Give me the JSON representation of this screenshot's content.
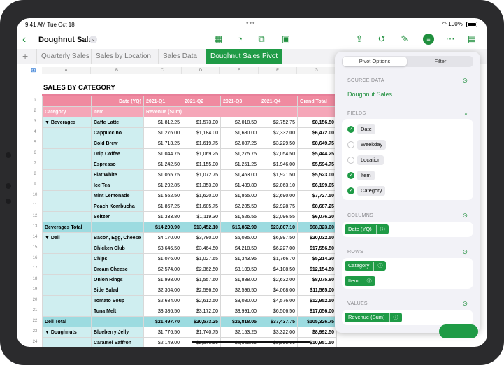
{
  "status": {
    "time": "9:41 AM  Tue Oct 18",
    "battery": "100%"
  },
  "toolbar": {
    "title": "Doughnut Sales"
  },
  "tabs": [
    "Quarterly Sales",
    "Sales by Location",
    "Sales Data",
    "Doughnut Sales Pivot"
  ],
  "sheet": {
    "title": "SALES BY CATEGORY",
    "columns": [
      "A",
      "B",
      "C",
      "D",
      "E",
      "F",
      "G"
    ],
    "header1": {
      "date_label": "Date (YQ)",
      "q1": "2021-Q1",
      "q2": "2021-Q2",
      "q3": "2021-Q3",
      "q4": "2021-Q4",
      "total": "Grand Total"
    },
    "header2": {
      "category": "Category",
      "item": "Item",
      "revenue": "Revenue (Sum)"
    },
    "rows": [
      {
        "n": "3",
        "cat": "▼ Beverages",
        "item": "Caffe Latte",
        "v": [
          "$1,812.25",
          "$1,573.00",
          "$2,018.50",
          "$2,752.75",
          "$8,156.50"
        ]
      },
      {
        "n": "4",
        "cat": "",
        "item": "Cappuccino",
        "v": [
          "$1,276.00",
          "$1,184.00",
          "$1,680.00",
          "$2,332.00",
          "$6,472.00"
        ]
      },
      {
        "n": "5",
        "cat": "",
        "item": "Cold Brew",
        "v": [
          "$1,713.25",
          "$1,619.75",
          "$2,087.25",
          "$3,229.50",
          "$8,649.75"
        ]
      },
      {
        "n": "6",
        "cat": "",
        "item": "Drip Coffee",
        "v": [
          "$1,044.75",
          "$1,069.25",
          "$1,275.75",
          "$2,054.50",
          "$5,444.25"
        ]
      },
      {
        "n": "7",
        "cat": "",
        "item": "Espresso",
        "v": [
          "$1,242.50",
          "$1,155.00",
          "$1,251.25",
          "$1,946.00",
          "$5,594.75"
        ]
      },
      {
        "n": "8",
        "cat": "",
        "item": "Flat White",
        "v": [
          "$1,065.75",
          "$1,072.75",
          "$1,463.00",
          "$1,921.50",
          "$5,523.00"
        ]
      },
      {
        "n": "9",
        "cat": "",
        "item": "Ice Tea",
        "v": [
          "$1,292.85",
          "$1,353.30",
          "$1,489.80",
          "$2,063.10",
          "$6,199.05"
        ]
      },
      {
        "n": "10",
        "cat": "",
        "item": "Mint Lemonade",
        "v": [
          "$1,552.50",
          "$1,620.00",
          "$1,865.00",
          "$2,690.00",
          "$7,727.50"
        ]
      },
      {
        "n": "11",
        "cat": "",
        "item": "Peach Kombucha",
        "v": [
          "$1,867.25",
          "$1,685.75",
          "$2,205.50",
          "$2,928.75",
          "$8,687.25"
        ]
      },
      {
        "n": "12",
        "cat": "",
        "item": "Seltzer",
        "v": [
          "$1,333.80",
          "$1,119.30",
          "$1,526.55",
          "$2,096.55",
          "$6,076.20"
        ]
      },
      {
        "n": "13",
        "cat": "Beverages Total",
        "item": "",
        "total": true,
        "v": [
          "$14,200.90",
          "$13,452.10",
          "$16,862.90",
          "$23,807.10",
          "$68,323.00"
        ]
      },
      {
        "n": "14",
        "cat": "▼ Deli",
        "item": "Bacon, Egg, Cheese",
        "v": [
          "$4,170.00",
          "$3,780.00",
          "$5,085.00",
          "$6,997.50",
          "$20,032.50"
        ]
      },
      {
        "n": "15",
        "cat": "",
        "item": "Chicken Club",
        "v": [
          "$3,646.50",
          "$3,464.50",
          "$4,218.50",
          "$6,227.00",
          "$17,556.50"
        ]
      },
      {
        "n": "16",
        "cat": "",
        "item": "Chips",
        "v": [
          "$1,076.00",
          "$1,027.65",
          "$1,343.95",
          "$1,766.70",
          "$5,214.30"
        ]
      },
      {
        "n": "17",
        "cat": "",
        "item": "Cream Cheese",
        "v": [
          "$2,574.00",
          "$2,362.50",
          "$3,109.50",
          "$4,108.50",
          "$12,154.50"
        ]
      },
      {
        "n": "18",
        "cat": "",
        "item": "Onion Rings",
        "v": [
          "$1,998.00",
          "$1,557.60",
          "$1,888.00",
          "$2,632.00",
          "$8,075.60"
        ]
      },
      {
        "n": "19",
        "cat": "",
        "item": "Side Salad",
        "v": [
          "$2,304.00",
          "$2,596.50",
          "$2,596.50",
          "$4,068.00",
          "$11,565.00"
        ]
      },
      {
        "n": "20",
        "cat": "",
        "item": "Tomato Soup",
        "v": [
          "$2,684.00",
          "$2,612.50",
          "$3,080.00",
          "$4,576.00",
          "$12,952.50"
        ]
      },
      {
        "n": "21",
        "cat": "",
        "item": "Tuna Melt",
        "v": [
          "$3,386.50",
          "$3,172.00",
          "$3,991.00",
          "$6,506.50",
          "$17,056.00"
        ]
      },
      {
        "n": "22",
        "cat": "Deli Total",
        "item": "",
        "total": true,
        "v": [
          "$21,497.70",
          "$20,573.25",
          "$25,818.05",
          "$37,437.75",
          "$105,326.75"
        ]
      },
      {
        "n": "23",
        "cat": "▼ Doughnuts",
        "item": "Blueberry Jelly",
        "v": [
          "$1,776.50",
          "$1,740.75",
          "$2,153.25",
          "$3,322.00",
          "$8,992.50"
        ]
      },
      {
        "n": "24",
        "cat": "",
        "item": "Caramel Saffron",
        "v": [
          "$2,149.00",
          "$2,376.00",
          "$2,588.00",
          "$3,838.00",
          "$10,951.50"
        ]
      }
    ]
  },
  "panel": {
    "tab_options": "Pivot Options",
    "tab_filter": "Filter",
    "source_label": "SOURCE DATA",
    "source_value": "Doughnut Sales",
    "fields_label": "FIELDS",
    "fields": [
      {
        "name": "Date",
        "checked": true
      },
      {
        "name": "Weekday",
        "checked": false
      },
      {
        "name": "Location",
        "checked": false
      },
      {
        "name": "Item",
        "checked": true
      },
      {
        "name": "Category",
        "checked": true
      }
    ],
    "columns_label": "COLUMNS",
    "columns": [
      "Date (YQ)"
    ],
    "rows_label": "ROWS",
    "rows": [
      "Category",
      "Item"
    ],
    "values_label": "VALUES",
    "values": [
      "Revenue (Sum)"
    ]
  },
  "colors": {
    "accent": "#1f9b46",
    "header_pink": "#f08aa0",
    "cell_cyan": "#cfeef0",
    "total_cyan": "#9cdbe0"
  }
}
